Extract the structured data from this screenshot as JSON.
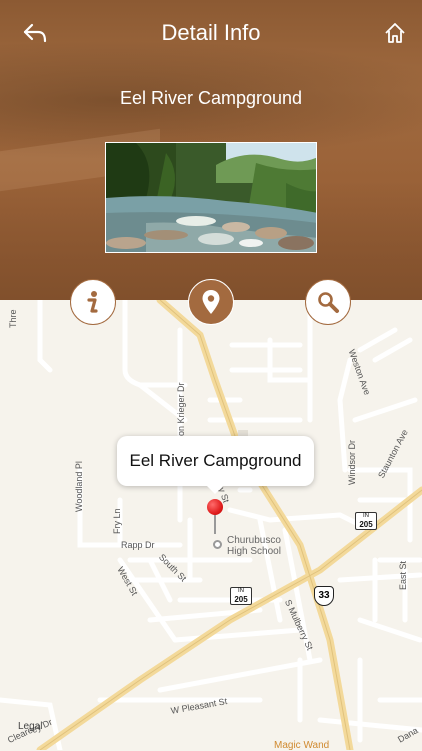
{
  "header": {
    "title": "Detail Info",
    "subtitle": "Eel River Campground",
    "back_icon": "back-arrow-icon",
    "home_icon": "home-icon"
  },
  "action_buttons": [
    {
      "icon": "info-icon"
    },
    {
      "icon": "map-pin-icon"
    },
    {
      "icon": "search-icon"
    }
  ],
  "map": {
    "callout": "Eel River Campground",
    "school": [
      "Churubusco",
      "High School"
    ],
    "streets": {
      "clear": "Cleare",
      "thre": "Thre",
      "von_krieger": "on Krieger Dr",
      "woodland": "Woodland Pl",
      "fry": "Fry Ln",
      "rapp": "Rapp Dr",
      "south": "South St",
      "west": "West St",
      "mulberry": "S Mulberry St",
      "weston": "Weston Ave",
      "windsor": "Windsor Dr",
      "staunton": "Staunton Ave",
      "east": "East St",
      "pleasant": "W Pleasant St",
      "ey": "ey Dr",
      "dana": "Dana",
      "st1": "St",
      "st2": "y St"
    },
    "shields": {
      "in205_a_top": "IN",
      "in205_a": "205",
      "in205_b_top": "IN",
      "in205_b": "205",
      "us33": "33"
    },
    "legal": "Legal",
    "poi": "Magic Wand"
  },
  "colors": {
    "accent": "#a36a3f",
    "header": "#9a6238",
    "map_bg": "#f6f3ec",
    "road_main": "#f3d99a"
  }
}
